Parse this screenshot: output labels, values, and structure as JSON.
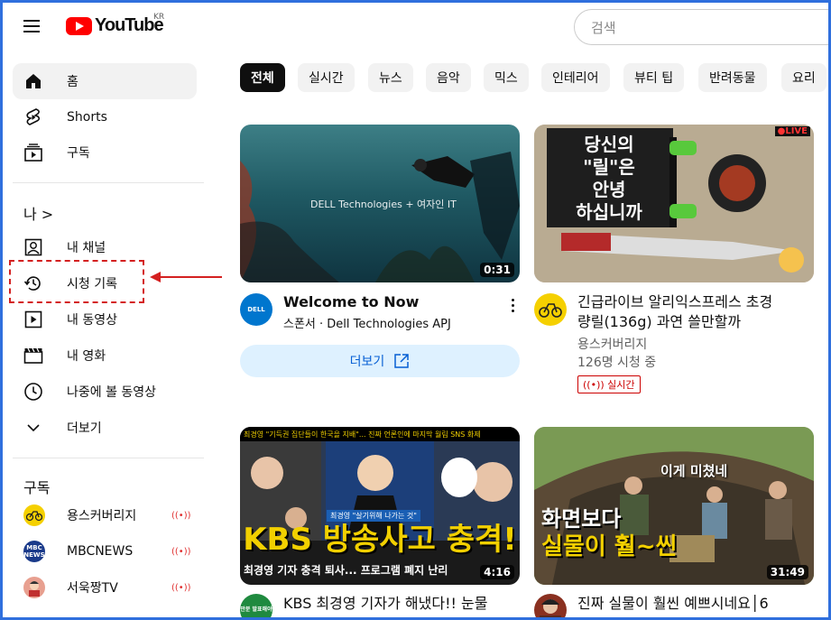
{
  "header": {
    "logo_text": "YouTube",
    "region": "KR",
    "search_placeholder": "검색"
  },
  "sidebar": {
    "main": [
      {
        "label": "홈",
        "icon": "home-icon",
        "active": true
      },
      {
        "label": "Shorts",
        "icon": "shorts-icon"
      },
      {
        "label": "구독",
        "icon": "subscriptions-icon"
      }
    ],
    "you_title": "나 >",
    "you": [
      {
        "label": "내 채널",
        "icon": "channel-icon"
      },
      {
        "label": "시청 기록",
        "icon": "history-icon"
      },
      {
        "label": "내 동영상",
        "icon": "my-videos-icon"
      },
      {
        "label": "내 영화",
        "icon": "movies-icon"
      },
      {
        "label": "나중에 볼 동영상",
        "icon": "watch-later-icon"
      },
      {
        "label": "더보기",
        "icon": "chevron-down-icon"
      }
    ],
    "subs_title": "구독",
    "subscriptions": [
      {
        "label": "용스커버리지",
        "live": true
      },
      {
        "label": "MBCNEWS",
        "live": true,
        "avatar_text": "MBC NEWS"
      },
      {
        "label": "서욱짱TV",
        "live": true
      }
    ],
    "live_symbol": "((•))"
  },
  "chips": [
    "전체",
    "실시간",
    "뉴스",
    "음악",
    "믹스",
    "인테리어",
    "뷰티 팁",
    "반려동물",
    "요리"
  ],
  "videos": [
    {
      "title": "Welcome to Now",
      "channel": "스폰서 · Dell Technologies APJ",
      "duration": "0:31",
      "thumb_text": "DELL Technologies  +  여자인 IT",
      "avatar_text": "DELL",
      "cta": "더보기"
    },
    {
      "title_line1": "긴급라이브 알리익스프레스 초경",
      "title_line2": "량릴(136g) 과연 쓸만할까",
      "channel": "용스커버리지",
      "views": "126명 시청 중",
      "live_label": "실시간",
      "live_symbol": "((•))",
      "thumb_text_lines": [
        "당신의",
        "\"릴\"은",
        "안녕",
        "하십니까"
      ],
      "badge": "●LIVE"
    },
    {
      "title": "KBS 최경영 기자가 해냈다!! 눈물",
      "duration": "4:16",
      "thumb_headline": "KBS 방송사고 충격!",
      "thumb_sub": "최경영 기자 충격 퇴사... 프로그램 폐지 난리",
      "thumb_top": "최경영 \"기득권 집단들이 한국을 지배\"... 진짜 언론인에 마지막 월림 SNS 화제",
      "thumb_caption": "최경영 \"살기위해 나가는 것\"",
      "avatar_text": "만분 발표해야"
    },
    {
      "title": "진짜 실물이 훨씬 예쁘시네요│6",
      "duration": "31:49",
      "thumb_top": "이게 미쳤네",
      "thumb_headline_1": "화면보다",
      "thumb_headline_2": "실물이 훨~씬"
    }
  ],
  "colors": {
    "youtube_red": "#ff0000",
    "frame_blue": "#2f6fdd",
    "annotation_red": "#d42020",
    "link_blue": "#065fd4"
  }
}
